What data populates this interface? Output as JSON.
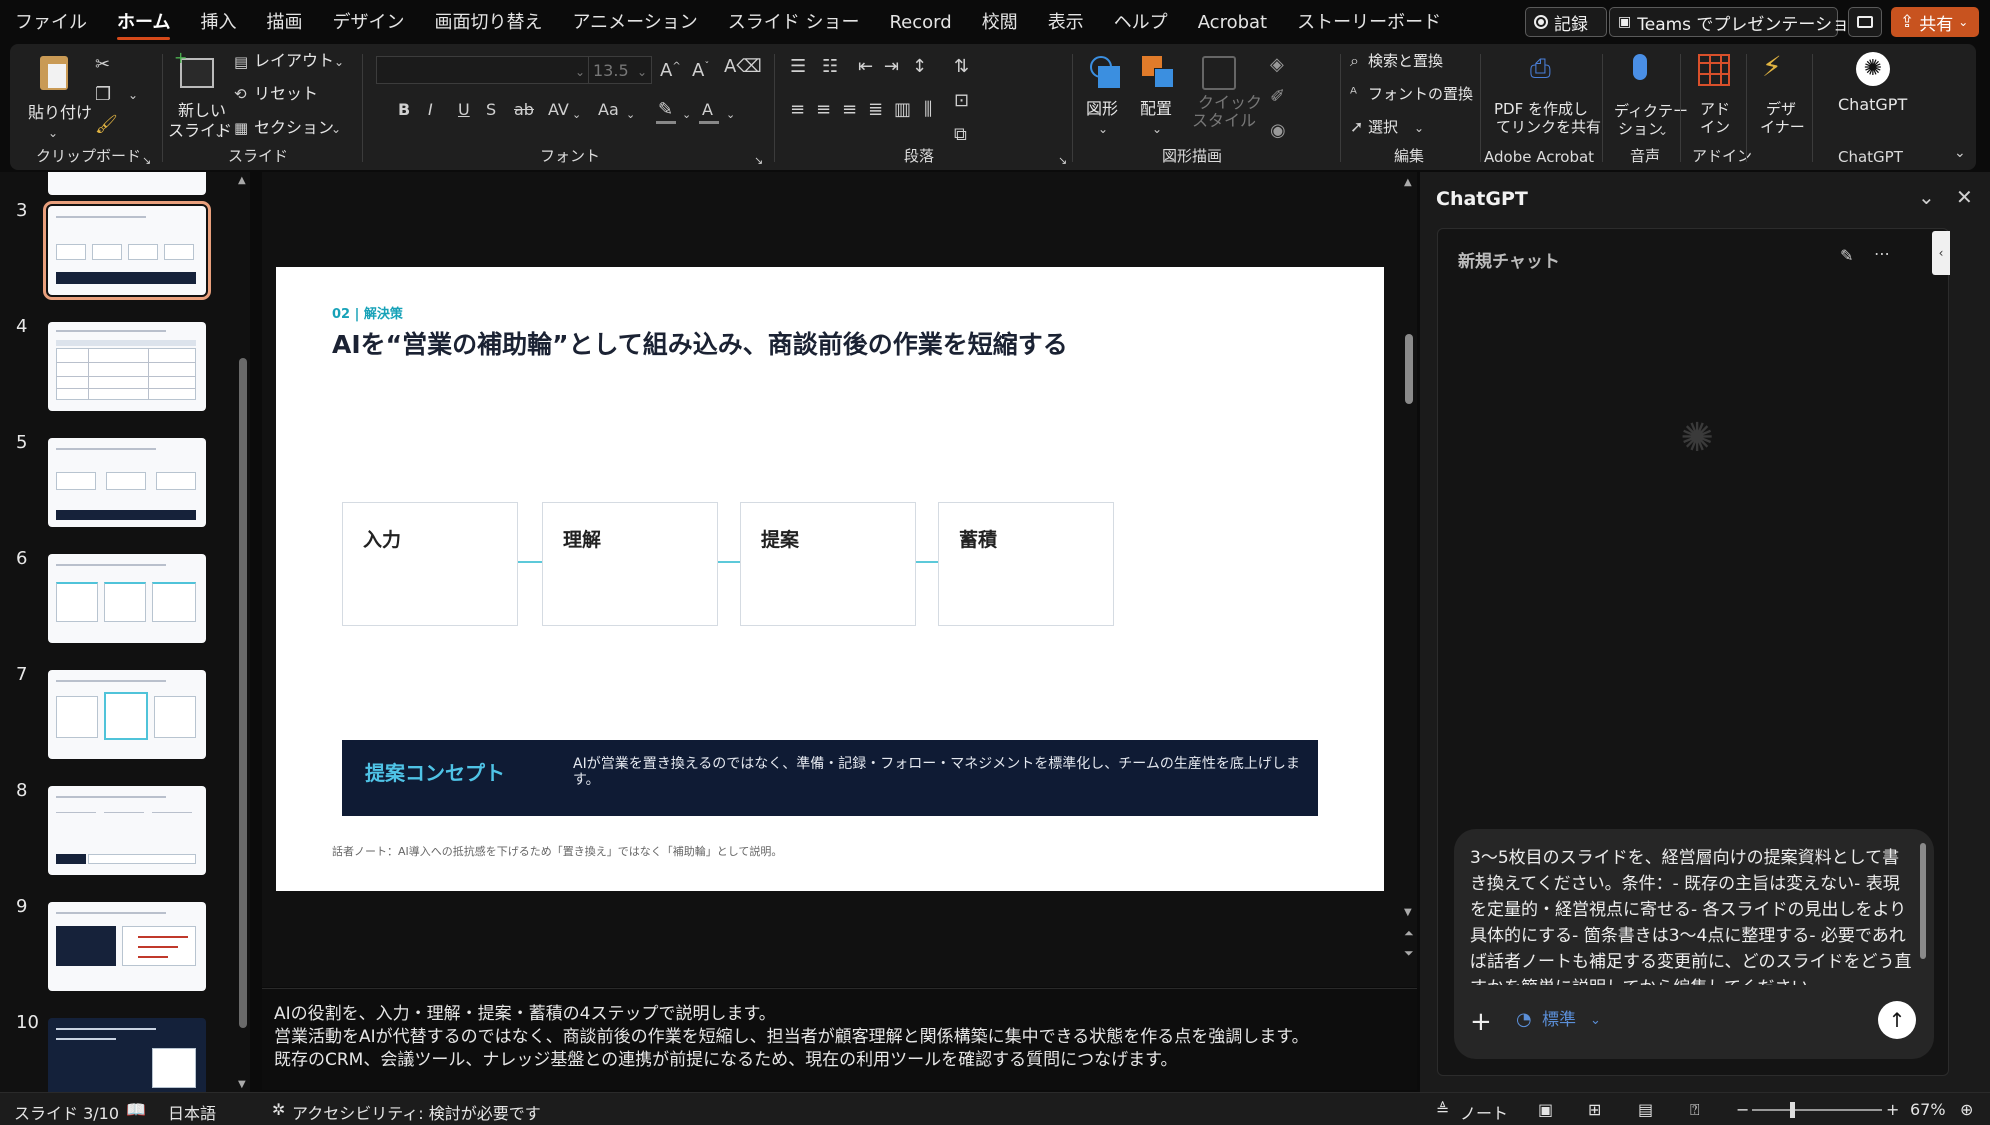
{
  "tabs": [
    "ファイル",
    "ホーム",
    "挿入",
    "描画",
    "デザイン",
    "画面切り替え",
    "アニメーション",
    "スライド ショー",
    "Record",
    "校閲",
    "表示",
    "ヘルプ",
    "Acrobat",
    "ストーリーボード"
  ],
  "active_tab": "ホーム",
  "titlebar_buttons": {
    "record": "記録",
    "teams": "Teams でプレゼンテーション",
    "share": "共有"
  },
  "ribbon": {
    "clipboard": {
      "paste": "貼り付け",
      "label": "クリップボード"
    },
    "slides": {
      "new_slide_line1": "新しい",
      "new_slide_line2": "スライド",
      "layout": "レイアウト",
      "reset": "リセット",
      "section": "セクション",
      "label": "スライド"
    },
    "font": {
      "size": "13.5",
      "label": "フォント"
    },
    "paragraph": {
      "label": "段落"
    },
    "drawing": {
      "shapes": "図形",
      "arrange": "配置",
      "quick_styles_1": "クイック",
      "quick_styles_2": "スタイル",
      "label": "図形描画"
    },
    "editing": {
      "find": "検索と置換",
      "replace_font": "フォントの置換",
      "select": "選択",
      "label": "編集"
    },
    "acrobat": {
      "btn_line1": "PDF を作成し",
      "btn_line2": "てリンクを共有",
      "label": "Adobe Acrobat"
    },
    "voice": {
      "btn_line1": "ディクテー",
      "btn_line2": "ション",
      "label": "音声"
    },
    "addins": {
      "btn_line1": "アド",
      "btn_line2": "イン",
      "label": "アドイン"
    },
    "designer": {
      "btn_line1": "デザ",
      "btn_line2": "イナー"
    },
    "chatgpt": {
      "btn": "ChatGPT",
      "label": "ChatGPT"
    }
  },
  "thumbnails": [
    "3",
    "4",
    "5",
    "6",
    "7",
    "8",
    "9",
    "10"
  ],
  "slide": {
    "kicker": "02 | 解決策",
    "title": "AIを“営業の補助輪”として組み込み、商談前後の作業を短縮する",
    "steps": [
      "入力",
      "理解",
      "提案",
      "蓄積"
    ],
    "band_heading": "提案コンセプト",
    "band_text": "AIが営業を置き換えるのではなく、準備・記録・フォロー・マネジメントを標準化し、チームの生産性を底上げします。",
    "note": "話者ノート：AI導入への抵抗感を下げるため「置き換え」ではなく「補助輪」として説明。"
  },
  "notes": [
    "AIの役割を、入力・理解・提案・蓄積の4ステップで説明します。",
    "営業活動をAIが代替するのではなく、商談前後の作業を短縮し、担当者が顧客理解と関係構築に集中できる状態を作る点を強調します。",
    "既存のCRM、会議ツール、ナレッジ基盤との連携が前提になるため、現在の利用ツールを確認する質問につなげます。"
  ],
  "pane": {
    "title": "ChatGPT",
    "chat_title": "新規チャット",
    "prompt": "3〜5枚目のスライドを、経営層向けの提案資料として書き換えてください。条件：- 既存の主旨は変えない- 表現を定量的・経営視点に寄せる- 各スライドの見出しをより具体的にする- 箇条書きは3〜4点に整理する- 必要であれば話者ノートも補足する変更前に、どのスライドをどう直すかを簡単に説明してから編集してください。",
    "mode": "標準"
  },
  "status": {
    "slide_indicator": "スライド 3/10",
    "language": "日本語",
    "accessibility": "アクセシビリティ: 検討が必要です",
    "notes_btn": "ノート",
    "zoom": "67%"
  },
  "colors": {
    "accent": "#d64a1a",
    "teal": "#17a2b8",
    "navy": "#0f1b34"
  }
}
